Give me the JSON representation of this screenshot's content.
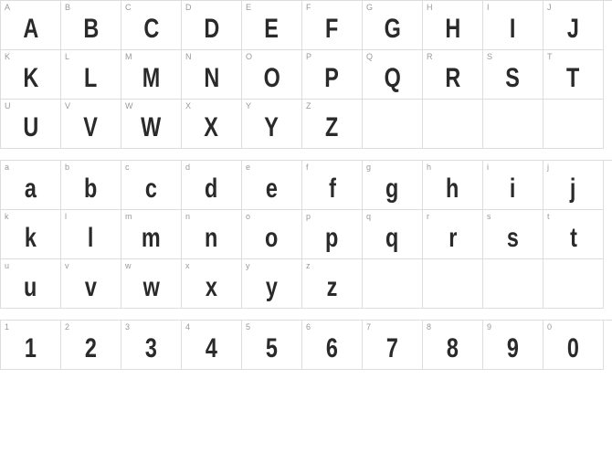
{
  "sections": [
    {
      "id": "uppercase",
      "cells": [
        {
          "label": "A",
          "glyph": "A"
        },
        {
          "label": "B",
          "glyph": "B"
        },
        {
          "label": "C",
          "glyph": "C"
        },
        {
          "label": "D",
          "glyph": "D"
        },
        {
          "label": "E",
          "glyph": "E"
        },
        {
          "label": "F",
          "glyph": "F"
        },
        {
          "label": "G",
          "glyph": "G"
        },
        {
          "label": "H",
          "glyph": "H"
        },
        {
          "label": "I",
          "glyph": "I"
        },
        {
          "label": "J",
          "glyph": "J"
        },
        {
          "label": "K",
          "glyph": "K"
        },
        {
          "label": "L",
          "glyph": "L"
        },
        {
          "label": "M",
          "glyph": "M"
        },
        {
          "label": "N",
          "glyph": "N"
        },
        {
          "label": "O",
          "glyph": "O"
        },
        {
          "label": "P",
          "glyph": "P"
        },
        {
          "label": "Q",
          "glyph": "Q"
        },
        {
          "label": "R",
          "glyph": "R"
        },
        {
          "label": "S",
          "glyph": "S"
        },
        {
          "label": "T",
          "glyph": "T"
        },
        {
          "label": "U",
          "glyph": "U"
        },
        {
          "label": "V",
          "glyph": "V"
        },
        {
          "label": "W",
          "glyph": "W"
        },
        {
          "label": "X",
          "glyph": "X"
        },
        {
          "label": "Y",
          "glyph": "Y"
        },
        {
          "label": "Z",
          "glyph": "Z"
        },
        {
          "label": "",
          "glyph": ""
        },
        {
          "label": "",
          "glyph": ""
        },
        {
          "label": "",
          "glyph": ""
        },
        {
          "label": "",
          "glyph": ""
        }
      ]
    },
    {
      "id": "lowercase",
      "cells": [
        {
          "label": "a",
          "glyph": "a"
        },
        {
          "label": "b",
          "glyph": "b"
        },
        {
          "label": "c",
          "glyph": "c"
        },
        {
          "label": "d",
          "glyph": "d"
        },
        {
          "label": "e",
          "glyph": "e"
        },
        {
          "label": "f",
          "glyph": "f"
        },
        {
          "label": "g",
          "glyph": "g"
        },
        {
          "label": "h",
          "glyph": "h"
        },
        {
          "label": "i",
          "glyph": "i"
        },
        {
          "label": "j",
          "glyph": "j"
        },
        {
          "label": "k",
          "glyph": "k"
        },
        {
          "label": "l",
          "glyph": "l"
        },
        {
          "label": "m",
          "glyph": "m"
        },
        {
          "label": "n",
          "glyph": "n"
        },
        {
          "label": "o",
          "glyph": "o"
        },
        {
          "label": "p",
          "glyph": "p"
        },
        {
          "label": "q",
          "glyph": "q"
        },
        {
          "label": "r",
          "glyph": "r"
        },
        {
          "label": "s",
          "glyph": "s"
        },
        {
          "label": "t",
          "glyph": "t"
        },
        {
          "label": "u",
          "glyph": "u"
        },
        {
          "label": "v",
          "glyph": "v"
        },
        {
          "label": "w",
          "glyph": "w"
        },
        {
          "label": "x",
          "glyph": "x"
        },
        {
          "label": "y",
          "glyph": "y"
        },
        {
          "label": "z",
          "glyph": "z"
        },
        {
          "label": "",
          "glyph": ""
        },
        {
          "label": "",
          "glyph": ""
        },
        {
          "label": "",
          "glyph": ""
        },
        {
          "label": "",
          "glyph": ""
        }
      ]
    },
    {
      "id": "digits",
      "cells": [
        {
          "label": "1",
          "glyph": "1"
        },
        {
          "label": "2",
          "glyph": "2"
        },
        {
          "label": "3",
          "glyph": "3"
        },
        {
          "label": "4",
          "glyph": "4"
        },
        {
          "label": "5",
          "glyph": "5"
        },
        {
          "label": "6",
          "glyph": "6"
        },
        {
          "label": "7",
          "glyph": "7"
        },
        {
          "label": "8",
          "glyph": "8"
        },
        {
          "label": "9",
          "glyph": "9"
        },
        {
          "label": "0",
          "glyph": "0"
        }
      ]
    }
  ]
}
